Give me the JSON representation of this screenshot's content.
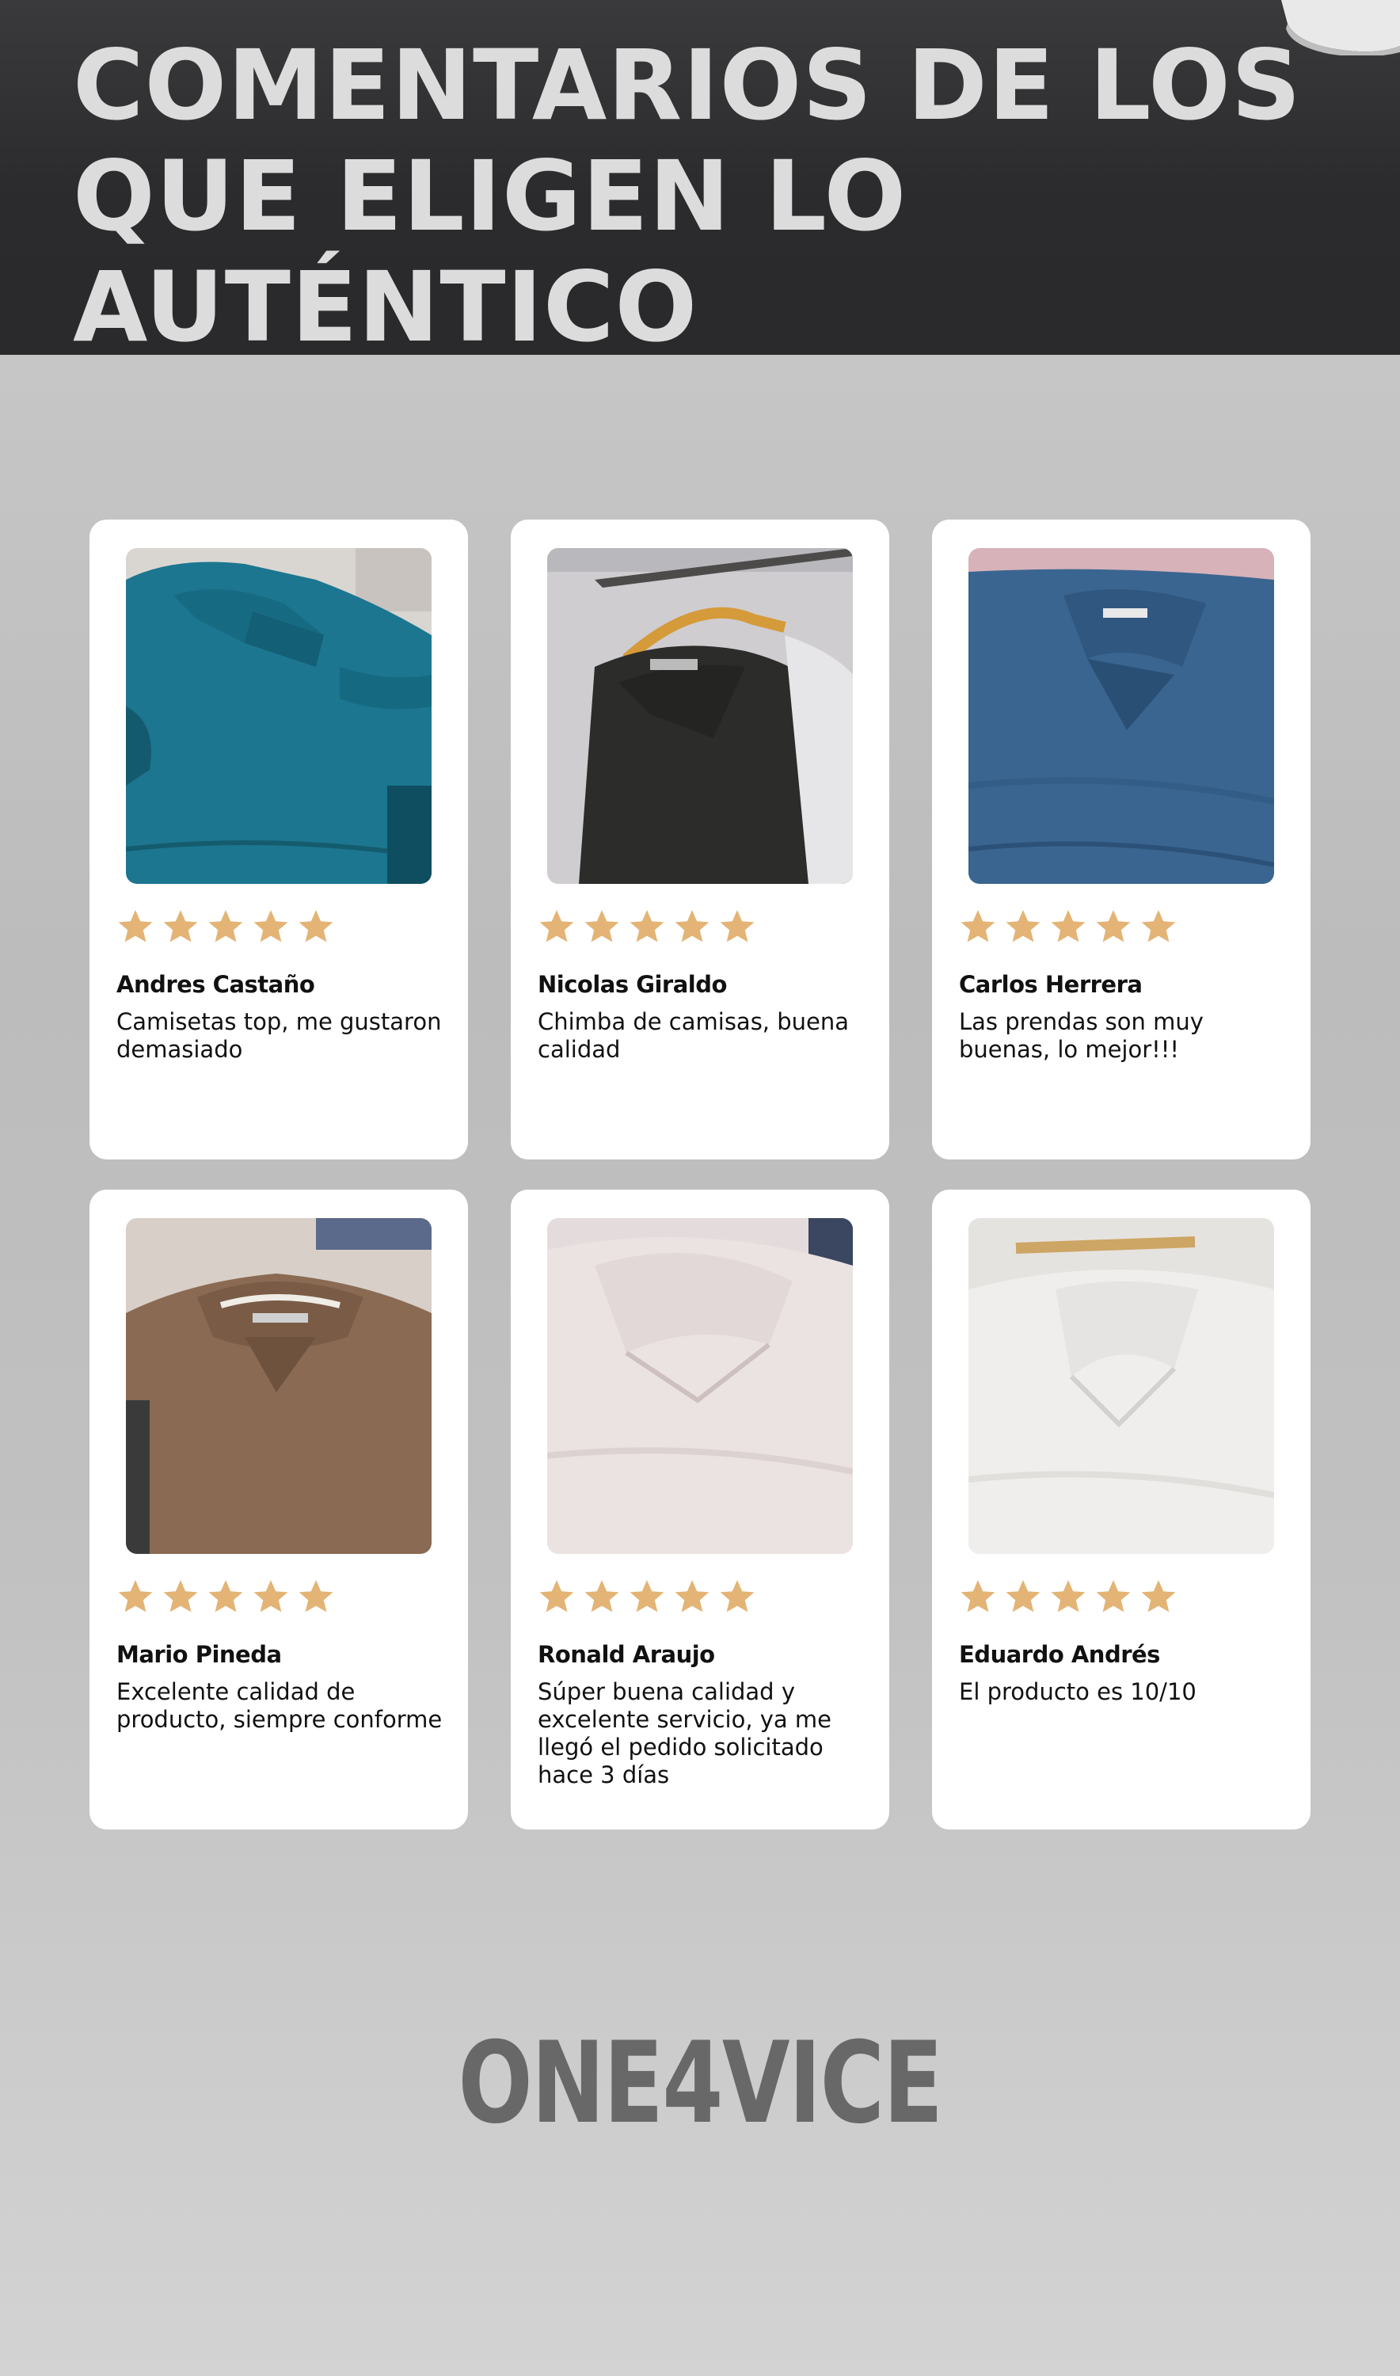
{
  "header": {
    "title_line1": "COMENTARIOS DE LOS",
    "title_line2": "QUE ELIGEN LO AUTÉNTICO"
  },
  "colors": {
    "header_bg": "#2b2b2d",
    "page_bg": "#c4c4c4",
    "star": "#e3b475",
    "brand": "#686868"
  },
  "reviews": [
    {
      "name": "Andres Castaño",
      "comment": "Camisetas top, me gustaron demasiado",
      "rating": 5,
      "shirt_color": "#1f7c95",
      "photo_icon": "teal-polo-shirt-photo"
    },
    {
      "name": "Nicolas Giraldo",
      "comment": "Chimba de camisas, buena calidad",
      "rating": 5,
      "shirt_color": "#2e2e2b",
      "photo_icon": "black-polo-shirt-photo"
    },
    {
      "name": "Carlos Herrera",
      "comment": "Las prendas son muy buenas, lo mejor!!!",
      "rating": 5,
      "shirt_color": "#3e6b95",
      "photo_icon": "blue-polo-shirt-photo"
    },
    {
      "name": "Mario Pineda",
      "comment": "Excelente calidad de producto, siempre conforme",
      "rating": 5,
      "shirt_color": "#8a6a52",
      "photo_icon": "brown-polo-shirt-photo"
    },
    {
      "name": "Ronald Araujo",
      "comment": "Súper buena calidad y excelente servicio, ya me llegó el pedido solicitado hace 3 días",
      "rating": 5,
      "shirt_color": "#e6dede",
      "photo_icon": "pink-polo-shirt-photo"
    },
    {
      "name": "Eduardo Andrés",
      "comment": "El producto es 10/10",
      "rating": 5,
      "shirt_color": "#eeeeec",
      "photo_icon": "white-polo-shirt-photo"
    }
  ],
  "footer": {
    "brand": "ONE4VICE"
  }
}
